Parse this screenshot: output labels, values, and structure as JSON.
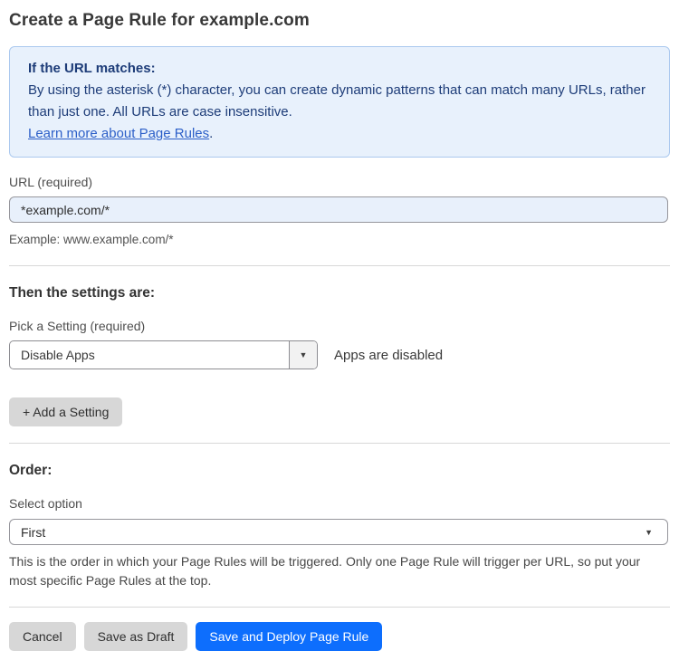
{
  "page": {
    "title": "Create a Page Rule for example.com"
  },
  "info_box": {
    "heading": "If the URL matches:",
    "body": "By using the asterisk (*) character, you can create dynamic patterns that can match many URLs, rather than just one. All URLs are case insensitive.",
    "link_label": "Learn more about Page Rules",
    "link_suffix": "."
  },
  "url_field": {
    "label": "URL (required)",
    "value": "*example.com/*",
    "helper": "Example: www.example.com/*"
  },
  "settings_section": {
    "heading": "Then the settings are:",
    "picker_label": "Pick a Setting (required)",
    "picker_value": "Disable Apps",
    "status_text": "Apps are disabled",
    "add_button_label": "+ Add a Setting"
  },
  "order_section": {
    "heading": "Order:",
    "select_label": "Select option",
    "select_value": "First",
    "helper": "This is the order in which your Page Rules will be triggered. Only one Page Rule will trigger per URL, so put your most specific Page Rules at the top."
  },
  "footer": {
    "cancel_label": "Cancel",
    "save_draft_label": "Save as Draft",
    "save_deploy_label": "Save and Deploy Page Rule"
  },
  "icons": {
    "dropdown_caret": "▼"
  },
  "colors": {
    "info_box_bg": "#e8f1fc",
    "info_box_border": "#abc9ef",
    "info_text": "#1d3c78",
    "link_blue": "#2c5fc8",
    "url_input_bg": "#e8f0fb",
    "primary_button_blue": "#0d6efd",
    "gray_button": "#d7d7d7"
  }
}
